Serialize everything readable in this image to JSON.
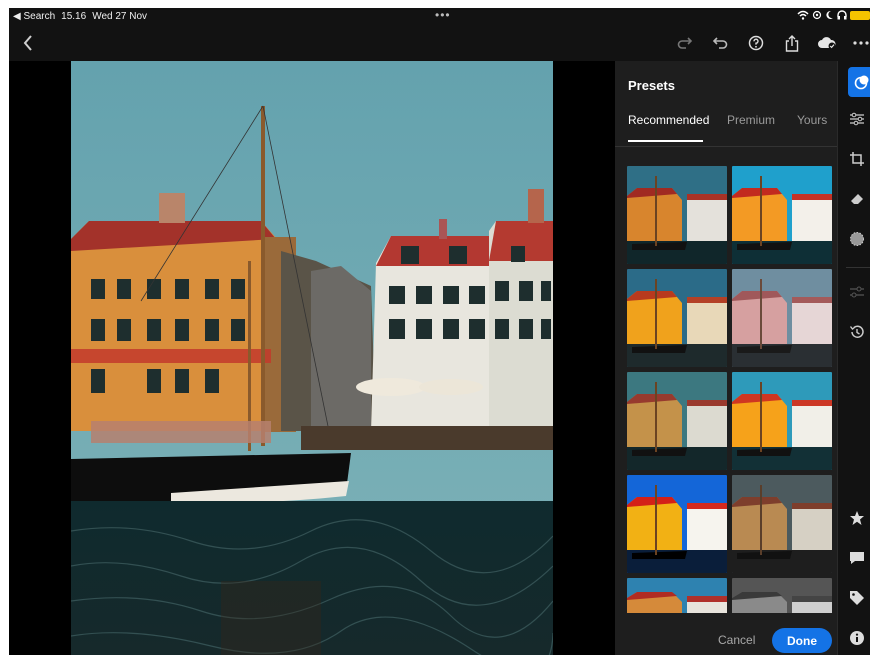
{
  "status_bar": {
    "back_app": "◀ Search",
    "time": "15.16",
    "date": "Wed 27 Nov",
    "multitask": "•••"
  },
  "toolbar": {
    "back_icon": "chevron-left-icon",
    "more_icon": "more-icon"
  },
  "presets_panel": {
    "title": "Presets",
    "tabs": [
      {
        "label": "Recommended",
        "active": true
      },
      {
        "label": "Premium",
        "active": false
      },
      {
        "label": "Yours",
        "active": false
      }
    ],
    "cancel_label": "Cancel",
    "done_label": "Done"
  },
  "thumbnails": [
    {
      "variant": "warm-teal"
    },
    {
      "variant": "vivid"
    },
    {
      "variant": "golden"
    },
    {
      "variant": "pink-fade"
    },
    {
      "variant": "muted-teal"
    },
    {
      "variant": "bright-warm"
    },
    {
      "variant": "high-contrast-blue"
    },
    {
      "variant": "brown-fade"
    },
    {
      "variant": "color-partial"
    },
    {
      "variant": "bw-partial"
    }
  ],
  "tool_rail": [
    {
      "name": "presets-icon",
      "active": true
    },
    {
      "name": "edit-sliders-icon"
    },
    {
      "name": "crop-icon"
    },
    {
      "name": "healing-icon"
    },
    {
      "name": "masking-icon"
    },
    {
      "name": "versions-icon"
    },
    {
      "name": "history-icon"
    },
    {
      "name": "rating-star-icon"
    },
    {
      "name": "comment-icon"
    },
    {
      "name": "tag-icon"
    },
    {
      "name": "info-icon"
    }
  ],
  "colors": {
    "accent": "#1473e6",
    "panel_bg": "#1e1e1e",
    "app_bg": "#121212",
    "sky": "#6ba3ad",
    "battery": "#f5c400"
  }
}
